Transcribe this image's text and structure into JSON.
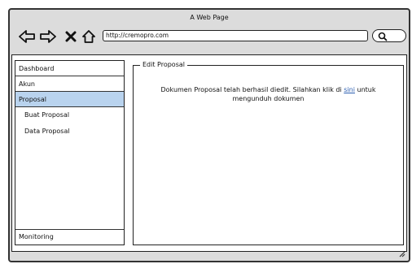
{
  "window": {
    "title": "A Web Page"
  },
  "toolbar": {
    "address": "http://cremopro.com"
  },
  "sidebar": {
    "items": [
      {
        "label": "Dashboard",
        "active": false
      },
      {
        "label": "Akun",
        "active": false
      },
      {
        "label": "Proposal",
        "active": true
      }
    ],
    "subitems": [
      {
        "label": "Buat Proposal"
      },
      {
        "label": "Data Proposal"
      }
    ],
    "bottom": {
      "label": "Monitoring"
    }
  },
  "main": {
    "section_title": "Edit Proposal",
    "message_before": "Dokumen Proposal telah berhasil diedit. Silahkan klik di",
    "link_text": "sini",
    "message_after": "untuk mengunduh dokumen"
  },
  "colors": {
    "active_bg": "#b9d3ee",
    "link": "#2a5db0",
    "chrome": "#dcdcdc"
  },
  "icons": [
    "back-arrow-icon",
    "forward-arrow-icon",
    "close-icon",
    "home-icon",
    "search-icon",
    "resize-grip-icon"
  ]
}
